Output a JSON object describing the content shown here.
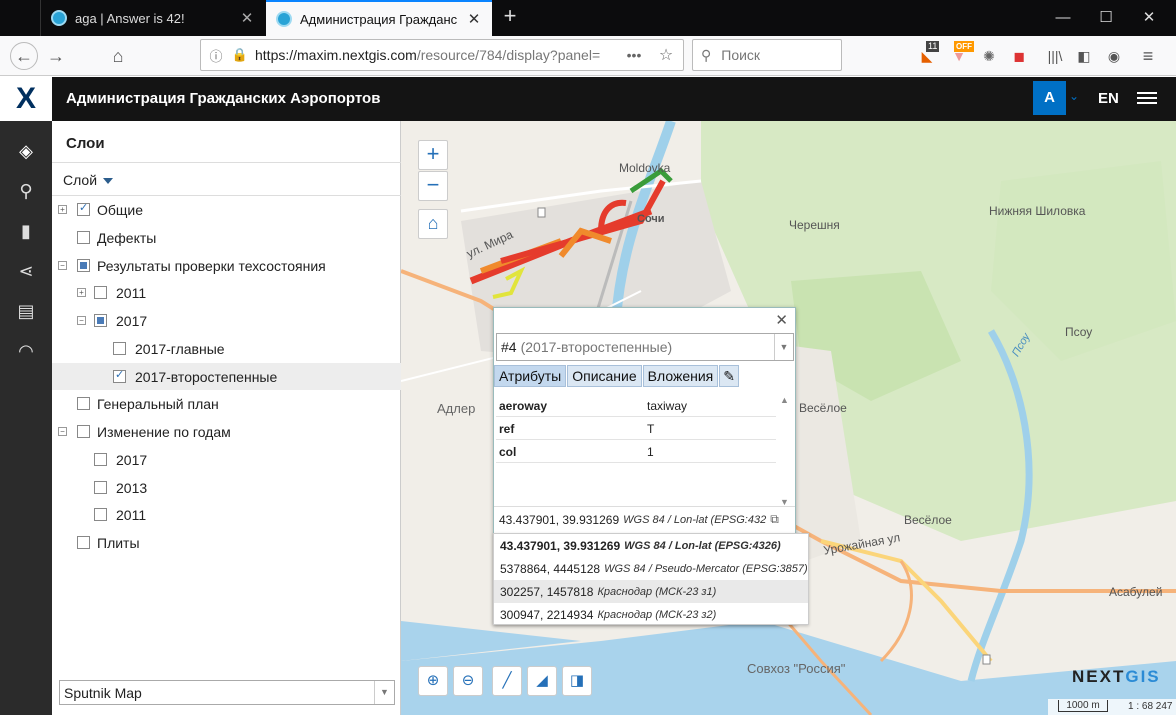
{
  "browser": {
    "tabs": [
      {
        "title": "aga | Answer is 42!"
      },
      {
        "title": "Администрация Гражданских"
      }
    ],
    "url_host": "https://maxim.nextgis.com",
    "url_path": "/resource/784/display?panel=",
    "search_placeholder": "Поиск",
    "ext_badge_1": "11",
    "ext_badge_2": "OFF"
  },
  "app": {
    "logo": "X",
    "title": "Администрация Гражданских Аэропортов",
    "avatar": "A",
    "lang": "EN"
  },
  "panel": {
    "title": "Слои",
    "layer_dropdown": "Слой",
    "tree": [
      {
        "label": "Общие",
        "toggle": "+",
        "state": "checked",
        "level": 0
      },
      {
        "label": "Дефекты",
        "toggle": "",
        "state": "empty",
        "level": 0
      },
      {
        "label": "Результаты проверки техсостояния",
        "toggle": "−",
        "state": "partial",
        "level": 0
      },
      {
        "label": "2011",
        "toggle": "+",
        "state": "empty",
        "level": 1
      },
      {
        "label": "2017",
        "toggle": "−",
        "state": "partial",
        "level": 1
      },
      {
        "label": "2017-главные",
        "toggle": "",
        "state": "empty",
        "level": 2
      },
      {
        "label": "2017-второстепенные",
        "toggle": "",
        "state": "checked",
        "level": 2,
        "selected": true
      },
      {
        "label": "Генеральный план",
        "toggle": "",
        "state": "empty",
        "level": 0
      },
      {
        "label": "Изменение по годам",
        "toggle": "−",
        "state": "empty",
        "level": 0
      },
      {
        "label": "2017",
        "toggle": "",
        "state": "empty",
        "level": 1
      },
      {
        "label": "2013",
        "toggle": "",
        "state": "empty",
        "level": 1
      },
      {
        "label": "2011",
        "toggle": "",
        "state": "empty",
        "level": 1
      },
      {
        "label": "Плиты",
        "toggle": "",
        "state": "empty",
        "level": 0
      }
    ],
    "basemap": "Sputnik Map"
  },
  "map": {
    "labels": {
      "moldovka": "Moldovka",
      "sochi": "Сочи",
      "mira": "ул. Мира",
      "chereshnya": "Черешня",
      "nizh_shilovka": "Нижняя Шиловка",
      "adler": "Адлер",
      "psou": "Псоу",
      "veseloe1": "Весёлое",
      "veseloe2": "Весёлое",
      "urozhaynaya": "Урожайная ул",
      "asabuley": "Асабулей",
      "sovkhoz": "Совхоз \"Россия\"",
      "psou_river": "Псоу"
    },
    "logo_a": "NEXT",
    "logo_b": "GIS",
    "scale_text": "1000 m",
    "scale_ratio": "1 : 68 247"
  },
  "popup": {
    "feature_id": "#4",
    "feature_layer": "(2017-второстепенные)",
    "tabs": [
      "Атрибуты",
      "Описание",
      "Вложения"
    ],
    "attributes": [
      {
        "key": "aeroway",
        "value": "taxiway"
      },
      {
        "key": "ref",
        "value": "T"
      },
      {
        "key": "col",
        "value": "1"
      }
    ],
    "coord_value": "43.437901, 39.931269",
    "coord_system": "WGS 84 / Lon-lat (EPSG:432"
  },
  "coord_options": [
    {
      "value": "43.437901, 39.931269",
      "system": "WGS 84 / Lon-lat (EPSG:4326)"
    },
    {
      "value": "5378864, 4445128",
      "system": "WGS 84 / Pseudo-Mercator (EPSG:3857)"
    },
    {
      "value": "302257, 1457818",
      "system": "Краснодар (МСК-23 з1)"
    },
    {
      "value": "300947, 2214934",
      "system": "Краснодар (МСК-23 з2)"
    }
  ]
}
